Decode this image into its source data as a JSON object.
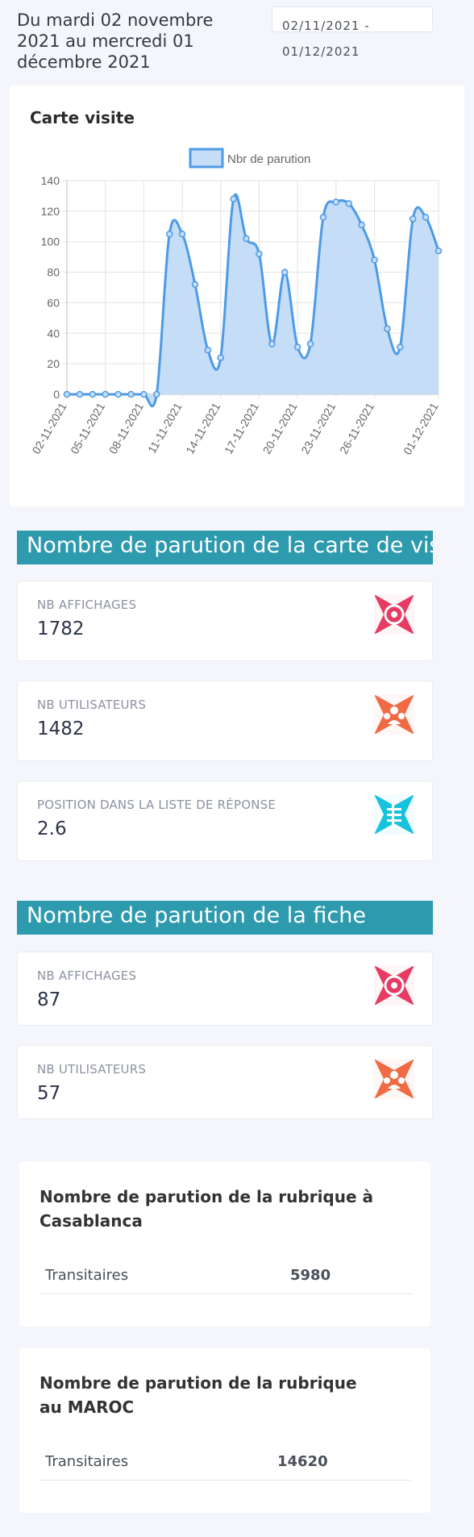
{
  "period": {
    "text": "Du mardi 02 novembre 2021 au mercredi 01 décembre 2021",
    "range_start": "02/11/2021 -",
    "range_end": "01/12/2021"
  },
  "chart_card": {
    "title": "Carte visite"
  },
  "chart_data": {
    "type": "area",
    "title": "Carte visite",
    "legend": [
      "Nbr de parution"
    ],
    "legend_position": "top",
    "grid": true,
    "ylim": [
      0,
      140
    ],
    "yticks": [
      0,
      20,
      40,
      60,
      80,
      100,
      120,
      140
    ],
    "xtick_labels": [
      "02-11-2021",
      "05-11-2021",
      "08-11-2021",
      "11-11-2021",
      "14-11-2021",
      "17-11-2021",
      "20-11-2021",
      "23-11-2021",
      "26-11-2021",
      "01-12-2021"
    ],
    "series": [
      {
        "name": "Nbr de parution",
        "color": "#4d9be6",
        "fill": "#c6ddf7",
        "x": [
          "02-11-2021",
          "03-11-2021",
          "04-11-2021",
          "05-11-2021",
          "06-11-2021",
          "07-11-2021",
          "08-11-2021",
          "09-11-2021",
          "10-11-2021",
          "11-11-2021",
          "12-11-2021",
          "13-11-2021",
          "14-11-2021",
          "15-11-2021",
          "16-11-2021",
          "17-11-2021",
          "18-11-2021",
          "19-11-2021",
          "20-11-2021",
          "21-11-2021",
          "22-11-2021",
          "23-11-2021",
          "24-11-2021",
          "25-11-2021",
          "26-11-2021",
          "27-11-2021",
          "28-11-2021",
          "29-11-2021",
          "30-11-2021",
          "01-12-2021"
        ],
        "values": [
          0,
          0,
          0,
          0,
          0,
          0,
          0,
          0,
          105,
          105,
          72,
          29,
          24,
          128,
          102,
          92,
          33,
          80,
          31,
          33,
          116,
          126,
          125,
          111,
          88,
          43,
          31,
          115,
          116,
          94
        ]
      }
    ]
  },
  "carte_section": {
    "title": "Nombre de parution de la carte de viste",
    "stats": [
      {
        "label": "NB AFFICHAGES",
        "value": "1782",
        "icon": "eye-icon",
        "color": "#e63b62"
      },
      {
        "label": "NB UTILISATEURS",
        "value": "1482",
        "icon": "users-icon",
        "color": "#f06a45"
      },
      {
        "label": "POSITION DANS LA LISTE DE RÉPONSE",
        "value": "2.6",
        "icon": "list-icon",
        "color": "#17c3dc"
      }
    ]
  },
  "fiche_section": {
    "title": "Nombre de parution de la fiche",
    "stats": [
      {
        "label": "NB AFFICHAGES",
        "value": "87",
        "icon": "eye-icon",
        "color": "#e63b62"
      },
      {
        "label": "NB UTILISATEURS",
        "value": "57",
        "icon": "users-icon",
        "color": "#f06a45"
      }
    ]
  },
  "rubrique_casablanca": {
    "title": "Nombre de parution de la rubrique à Casablanca",
    "rows": [
      {
        "name": "Transitaires",
        "value": "5980"
      }
    ]
  },
  "rubrique_maroc": {
    "title": "Nombre de parution de la rubrique au MAROC",
    "rows": [
      {
        "name": "Transitaires",
        "value": "14620"
      }
    ]
  }
}
